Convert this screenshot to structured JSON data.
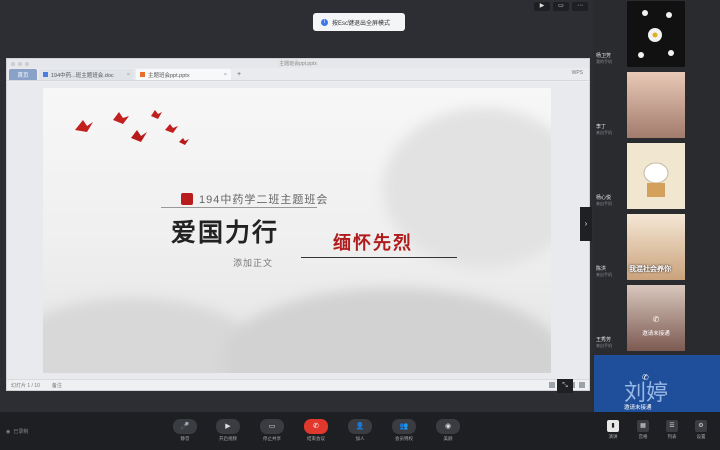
{
  "toast": {
    "text": "按Esc键退出全屏模式"
  },
  "top_icons": [
    "▶",
    "▭",
    "⋯"
  ],
  "window": {
    "title": "主题班会ppt.pptx",
    "tabs": [
      {
        "label": "首页"
      },
      {
        "label": "194中药...班主题班会.doc"
      },
      {
        "label": "主题班会ppt.pptx"
      }
    ],
    "add_tab": "+",
    "account": "WPS"
  },
  "slide": {
    "subtitle": "194中药学二班主题班会",
    "title": "爱国力行",
    "red_title": "缅怀先烈",
    "add_text": "添加正文"
  },
  "statusbar": {
    "page": "幻灯片 1 / 10",
    "note": "备注"
  },
  "participants": [
    {
      "name": "杨卫芳",
      "sub": "我的手机"
    },
    {
      "name": "李丁",
      "sub": "来自手机"
    },
    {
      "name": "杨心悦",
      "sub": "来自手机"
    },
    {
      "name": "陈洪",
      "sub": "来自手机",
      "overlay": "我混社会养你"
    },
    {
      "name": "王秀芳",
      "sub": "来自手机",
      "overlay": "邀请未接通"
    },
    {
      "name": "",
      "sub": "",
      "overlay": "刘婷",
      "overlay2": "邀请未接通"
    }
  ],
  "bottombar": {
    "left": "已录制",
    "buttons": [
      {
        "icon": "🎤",
        "label": "静音"
      },
      {
        "icon": "▶",
        "label": "开启视频"
      },
      {
        "icon": "▭",
        "label": "停止共享"
      },
      {
        "icon": "✆",
        "label": "结束会议"
      },
      {
        "icon": "👤",
        "label": "加人"
      },
      {
        "icon": "👥",
        "label": "会员特权"
      },
      {
        "icon": "◉",
        "label": "美颜"
      }
    ],
    "right_buttons": [
      {
        "icon": "▮",
        "label": "演讲"
      },
      {
        "icon": "▦",
        "label": "宫格"
      },
      {
        "icon": "☰",
        "label": "列表"
      },
      {
        "icon": "⚙",
        "label": "设置"
      }
    ]
  }
}
